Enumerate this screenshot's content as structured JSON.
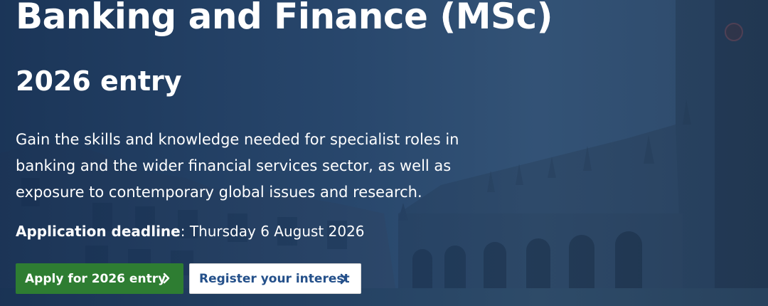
{
  "hero": {
    "title": "Banking and Finance (MSc)",
    "subtitle": "2026 entry",
    "description": "Gain the skills and knowledge needed for specialist roles in banking and the wider financial services sector, as well as exposure to contemporary global issues and research.",
    "deadline_label": "Application deadline",
    "deadline_value": ": Thursday 6 August 2026",
    "background_image": "university-quad-building"
  },
  "buttons": {
    "apply_label": "Apply for 2026 entry",
    "register_label": "Register your interest",
    "icon": "chevron-right-icon"
  },
  "colors": {
    "apply_bg": "#2e7d32",
    "register_text": "#24508a",
    "overlay": "#1f3f63"
  }
}
